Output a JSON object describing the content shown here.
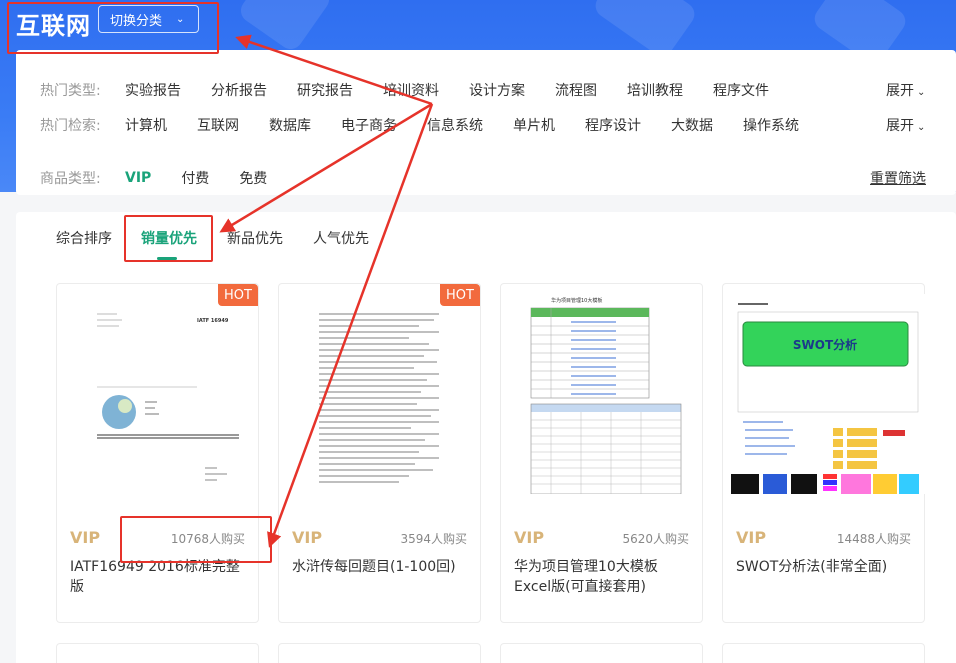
{
  "header": {
    "logo": "互联网",
    "switch_label": "切换分类"
  },
  "filters": {
    "hot_types": {
      "label": "热门类型:",
      "items": [
        "实验报告",
        "分析报告",
        "研究报告",
        "培训资料",
        "设计方案",
        "流程图",
        "培训教程",
        "程序文件"
      ],
      "expand": "展开"
    },
    "hot_search": {
      "label": "热门检索:",
      "items": [
        "计算机",
        "互联网",
        "数据库",
        "电子商务",
        "信息系统",
        "单片机",
        "程序设计",
        "大数据",
        "操作系统"
      ],
      "expand": "展开"
    },
    "product_type": {
      "label": "商品类型:",
      "items": [
        "VIP",
        "付费",
        "免费"
      ]
    },
    "reset": "重置筛选"
  },
  "sort_tabs": [
    "综合排序",
    "销量优先",
    "新品优先",
    "人气优先"
  ],
  "cards": [
    {
      "hot": "HOT",
      "vip": "VIP",
      "buys": "10768人购买",
      "title": "IATF16949 2016标准完整版"
    },
    {
      "hot": "HOT",
      "vip": "VIP",
      "buys": "3594人购买",
      "title": "水浒传每回题目(1-100回)"
    },
    {
      "hot": "",
      "vip": "VIP",
      "buys": "5620人购买",
      "title": "华为项目管理10大模板Excel版(可直接套用)"
    },
    {
      "hot": "",
      "vip": "VIP",
      "buys": "14488人购买",
      "title": "SWOT分析法(非常全面)"
    }
  ],
  "thumbs": {
    "doc1_code": "IATF 16949",
    "table_title": "华为项目管理10大模板",
    "swot_title": "SWOT分析"
  },
  "colors": {
    "accent": "#1aa37a",
    "hot": "#f26a3d",
    "vip": "#d8b479",
    "annotation": "#e6332a",
    "banner": "#2f6ef0"
  }
}
